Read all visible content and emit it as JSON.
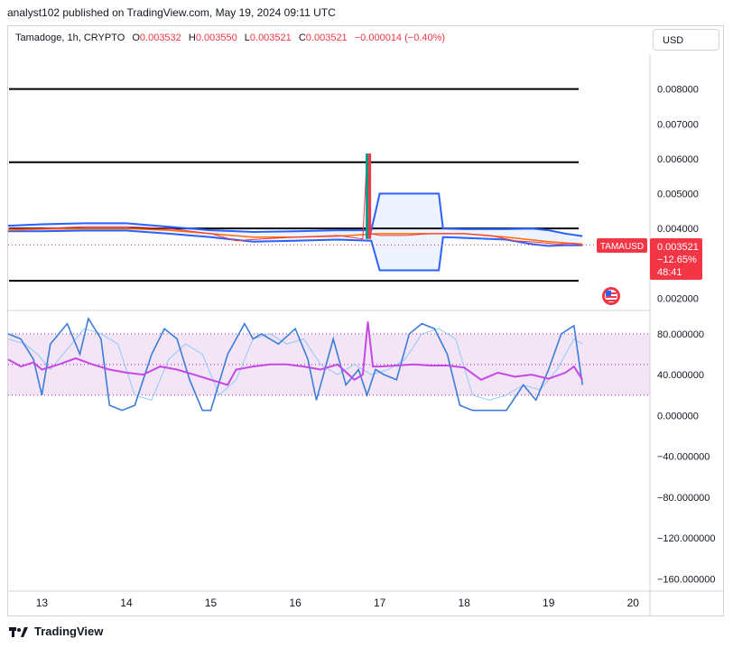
{
  "publish_line": "analyst102 published on TradingView.com, May 19, 2024 09:11 UTC",
  "legend": {
    "symbol": "Tamadoge, 1h, CRYPTO",
    "o_label": "O",
    "o": "0.003532",
    "h_label": "H",
    "h": "0.003550",
    "l_label": "L",
    "l": "0.003521",
    "c_label": "C",
    "c": "0.003521",
    "change": "−0.000014 (−0.40%)"
  },
  "currency_button": "USD",
  "price_tag": {
    "ticker": "TAMAUSD",
    "price": "0.003521",
    "change_pct": "−12.65%",
    "countdown": "48:41"
  },
  "footer_brand": "TradingView",
  "colors": {
    "down": "#f23645",
    "up": "#089981",
    "band": "#2962ff",
    "ma_orange": "#ff6d00",
    "stoch_k": "#3b7dd8",
    "stoch_d": "#9c27b0",
    "rsi": "#c548e6",
    "zone": "#f3e5f5",
    "level": "#000000"
  },
  "chart_data": [
    {
      "type": "line",
      "pane": "price",
      "x_labels": [
        "13",
        "14",
        "15",
        "16",
        "17",
        "18",
        "19",
        "20"
      ],
      "x_range": [
        12.6,
        20.2
      ],
      "y_ticks": [
        "0.008000",
        "0.007000",
        "0.006000",
        "0.005000",
        "0.004000",
        "0.002000"
      ],
      "ylim": [
        0.0017,
        0.009
      ],
      "horizontal_levels": [
        0.008,
        0.0059,
        0.004,
        0.0025
      ],
      "series": [
        {
          "key": "price",
          "x": [
            12.6,
            13.0,
            13.5,
            14.0,
            14.5,
            15.0,
            15.3,
            15.6,
            16.0,
            16.5,
            16.8,
            16.85,
            16.9,
            17.0,
            17.3,
            17.6,
            17.8,
            18.0,
            18.3,
            18.6,
            18.9,
            19.1,
            19.3,
            19.4
          ],
          "y": [
            0.004,
            0.004,
            0.00405,
            0.00405,
            0.004,
            0.00385,
            0.00365,
            0.0037,
            0.00375,
            0.0038,
            0.0037,
            0.00615,
            0.00385,
            0.0038,
            0.0038,
            0.00385,
            0.00385,
            0.00385,
            0.0038,
            0.00365,
            0.0036,
            0.00355,
            0.00358,
            0.003521
          ]
        },
        {
          "key": "ma",
          "x": [
            12.6,
            13.0,
            13.5,
            14.0,
            14.5,
            15.0,
            15.5,
            16.0,
            16.5,
            17.0,
            17.5,
            18.0,
            18.5,
            19.0,
            19.4
          ],
          "y": [
            0.00395,
            0.00398,
            0.004,
            0.004,
            0.00395,
            0.00385,
            0.00375,
            0.00375,
            0.00378,
            0.00385,
            0.00385,
            0.00385,
            0.00375,
            0.00362,
            0.00355
          ]
        },
        {
          "key": "band_upper",
          "x": [
            12.6,
            13.0,
            13.5,
            14.0,
            14.5,
            15.0,
            15.5,
            16.0,
            16.5,
            16.9,
            17.0,
            17.7,
            17.75,
            18.0,
            18.5,
            18.8,
            19.0,
            19.2,
            19.4
          ],
          "y": [
            0.00408,
            0.00412,
            0.00415,
            0.00415,
            0.00405,
            0.00395,
            0.0039,
            0.00392,
            0.00395,
            0.00395,
            0.005,
            0.005,
            0.004,
            0.00398,
            0.00398,
            0.004,
            0.00395,
            0.00385,
            0.00378
          ]
        },
        {
          "key": "band_lower",
          "x": [
            12.6,
            13.0,
            13.5,
            14.0,
            14.5,
            15.0,
            15.5,
            16.0,
            16.5,
            16.9,
            17.0,
            17.7,
            17.75,
            18.0,
            18.5,
            18.8,
            19.0,
            19.2,
            19.4
          ],
          "y": [
            0.00392,
            0.00392,
            0.00394,
            0.00394,
            0.00385,
            0.00375,
            0.00362,
            0.00365,
            0.00368,
            0.00365,
            0.0028,
            0.0028,
            0.00375,
            0.00373,
            0.00368,
            0.00355,
            0.0035,
            0.00352,
            0.00352
          ]
        }
      ]
    },
    {
      "type": "line",
      "pane": "oscillator",
      "x_labels": [
        "13",
        "14",
        "15",
        "16",
        "17",
        "18",
        "19",
        "20"
      ],
      "x_range": [
        12.6,
        20.2
      ],
      "y_ticks": [
        "80.000000",
        "40.000000",
        "0.000000",
        "−40.000000",
        "−80.000000",
        "−120.000000",
        "−160.000000"
      ],
      "ylim": [
        -172,
        102
      ],
      "zone": [
        20,
        80
      ],
      "dotted_levels": [
        80,
        50,
        20
      ],
      "series": [
        {
          "key": "stoch_k",
          "x": [
            12.6,
            12.75,
            12.9,
            13.0,
            13.1,
            13.3,
            13.45,
            13.55,
            13.7,
            13.8,
            13.95,
            14.1,
            14.3,
            14.45,
            14.6,
            14.75,
            14.9,
            15.0,
            15.2,
            15.4,
            15.5,
            15.6,
            15.8,
            16.0,
            16.15,
            16.25,
            16.45,
            16.6,
            16.75,
            16.85,
            16.95,
            17.05,
            17.2,
            17.35,
            17.5,
            17.65,
            17.8,
            17.95,
            18.1,
            18.3,
            18.5,
            18.7,
            18.85,
            19.0,
            19.15,
            19.3,
            19.4
          ],
          "y": [
            80,
            75,
            55,
            20,
            70,
            90,
            60,
            95,
            75,
            10,
            5,
            10,
            60,
            85,
            75,
            35,
            5,
            5,
            60,
            90,
            75,
            80,
            70,
            85,
            55,
            15,
            75,
            30,
            45,
            20,
            45,
            40,
            35,
            80,
            90,
            85,
            60,
            10,
            5,
            5,
            5,
            30,
            15,
            45,
            80,
            88,
            30
          ]
        },
        {
          "key": "stoch_d",
          "x": [
            12.6,
            12.8,
            12.95,
            13.1,
            13.3,
            13.5,
            13.7,
            13.9,
            14.1,
            14.3,
            14.5,
            14.7,
            14.9,
            15.1,
            15.3,
            15.5,
            15.7,
            15.9,
            16.1,
            16.3,
            16.5,
            16.7,
            16.9,
            17.1,
            17.3,
            17.5,
            17.7,
            17.9,
            18.1,
            18.3,
            18.5,
            18.7,
            18.9,
            19.1,
            19.3,
            19.4
          ],
          "y": [
            75,
            70,
            60,
            45,
            65,
            85,
            80,
            70,
            20,
            15,
            55,
            70,
            60,
            20,
            35,
            75,
            80,
            70,
            75,
            50,
            40,
            50,
            40,
            45,
            55,
            80,
            85,
            75,
            20,
            15,
            20,
            30,
            25,
            45,
            75,
            70
          ]
        },
        {
          "key": "rsi",
          "x": [
            12.6,
            12.75,
            12.9,
            13.0,
            13.2,
            13.4,
            13.6,
            13.8,
            14.0,
            14.2,
            14.4,
            14.6,
            14.8,
            15.0,
            15.2,
            15.3,
            15.5,
            15.7,
            15.9,
            16.1,
            16.3,
            16.5,
            16.7,
            16.8,
            16.86,
            16.92,
            17.0,
            17.2,
            17.4,
            17.6,
            17.8,
            18.0,
            18.2,
            18.4,
            18.6,
            18.8,
            19.0,
            19.2,
            19.3,
            19.4
          ],
          "y": [
            55,
            48,
            52,
            45,
            50,
            56,
            50,
            45,
            42,
            40,
            48,
            45,
            40,
            35,
            30,
            45,
            48,
            50,
            50,
            48,
            45,
            50,
            35,
            40,
            92,
            48,
            48,
            49,
            50,
            49,
            49,
            47,
            35,
            42,
            38,
            40,
            36,
            42,
            48,
            35
          ]
        }
      ]
    }
  ]
}
